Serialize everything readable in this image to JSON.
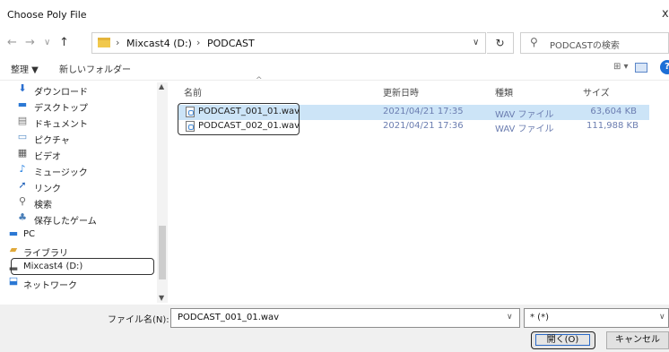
{
  "window": {
    "title": "Choose Poly File",
    "close": "x"
  },
  "nav": {
    "back": "←",
    "forward": "→",
    "recent": "∨",
    "up": "↑"
  },
  "address": {
    "crumbs": [
      "Mixcast4 (D:)",
      "PODCAST"
    ],
    "separator": "›",
    "dropdown": "∨"
  },
  "refresh": "↻",
  "search": {
    "placeholder": "PODCASTの検索"
  },
  "toolbar": {
    "organize": "整理 ▼",
    "new_folder": "新しいフォルダー",
    "view": "⊞ ▾",
    "help": "?"
  },
  "sidebar": {
    "items": [
      {
        "label": "ダウンロード",
        "icon": "download-arrow-icon",
        "glyph": "⬇",
        "color": "#2b6fd0"
      },
      {
        "label": "デスクトップ",
        "icon": "desktop-icon",
        "glyph": "▬",
        "color": "#2b78d4"
      },
      {
        "label": "ドキュメント",
        "icon": "document-icon",
        "glyph": "▤",
        "color": "#777777"
      },
      {
        "label": "ピクチャ",
        "icon": "pictures-icon",
        "glyph": "▭",
        "color": "#5a8fc8"
      },
      {
        "label": "ビデオ",
        "icon": "video-icon",
        "glyph": "▦",
        "color": "#555555"
      },
      {
        "label": "ミュージック",
        "icon": "music-icon",
        "glyph": "♪",
        "color": "#1f7de0"
      },
      {
        "label": "リンク",
        "icon": "link-icon",
        "glyph": "➚",
        "color": "#1d5fb8"
      },
      {
        "label": "検索",
        "icon": "search-icon",
        "glyph": "⚲",
        "color": "#666666"
      },
      {
        "label": "保存したゲーム",
        "icon": "saved-games-icon",
        "glyph": "♣",
        "color": "#4a7fb8"
      },
      {
        "label": "PC",
        "icon": "pc-icon",
        "glyph": "▬",
        "color": "#2b78d4"
      },
      {
        "label": "ライブラリ",
        "icon": "library-icon",
        "glyph": "▰",
        "color": "#e0a93a"
      },
      {
        "label": "Mixcast4 (D:)",
        "icon": "drive-icon",
        "glyph": "▂",
        "color": "#555555"
      },
      {
        "label": "ネットワーク",
        "icon": "network-icon",
        "glyph": "⬓",
        "color": "#2b78d4"
      }
    ],
    "scroll_up": "▲",
    "scroll_down": "▼"
  },
  "columns": {
    "name": "名前",
    "date": "更新日時",
    "type": "種類",
    "size": "サイズ",
    "sort_caret": "^"
  },
  "files": [
    {
      "name": "PODCAST_001_01.wav",
      "date": "2021/04/21 17:35",
      "type": "WAV ファイル",
      "size": "63,604 KB"
    },
    {
      "name": "PODCAST_002_01.wav",
      "date": "2021/04/21 17:36",
      "type": "WAV ファイル",
      "size": "111,988 KB"
    }
  ],
  "footer": {
    "filename_label": "ファイル名(N):",
    "filename_value": "PODCAST_001_01.wav",
    "filter_value": "* (*)",
    "dropdown": "∨",
    "open_label": "開く(O)",
    "cancel_label": "キャンセル"
  }
}
